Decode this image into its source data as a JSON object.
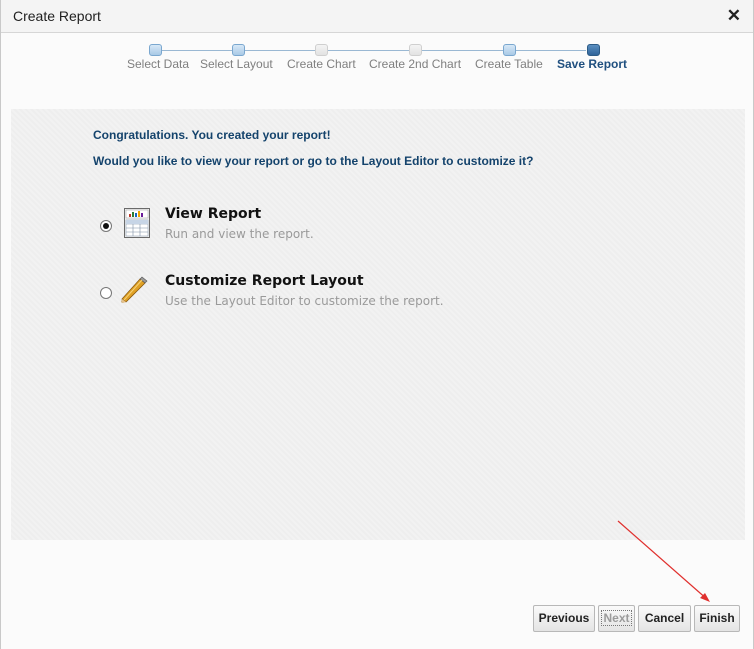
{
  "dialog": {
    "title": "Create Report",
    "close_glyph": "✕"
  },
  "train": {
    "steps": [
      {
        "label": "Select Data",
        "state": "visited"
      },
      {
        "label": "Select Layout",
        "state": "visited"
      },
      {
        "label": "Create Chart",
        "state": "disabled"
      },
      {
        "label": "Create 2nd Chart",
        "state": "disabled"
      },
      {
        "label": "Create Table",
        "state": "visited"
      },
      {
        "label": "Save Report",
        "state": "current"
      }
    ]
  },
  "content": {
    "congrats": "Congratulations. You created your report!",
    "question": "Would you like to view your report or go to the Layout Editor to customize it?",
    "options": [
      {
        "title": "View Report",
        "description": "Run and view the report.",
        "selected": true,
        "icon": "report-table-icon"
      },
      {
        "title": "Customize Report Layout",
        "description": "Use the Layout Editor to customize the report.",
        "selected": false,
        "icon": "pencil-icon"
      }
    ]
  },
  "buttons": {
    "previous": "Previous",
    "next": "Next",
    "cancel": "Cancel",
    "finish": "Finish"
  },
  "colors": {
    "accent": "#1f4f7f",
    "annotation_arrow": "#e0302e"
  }
}
